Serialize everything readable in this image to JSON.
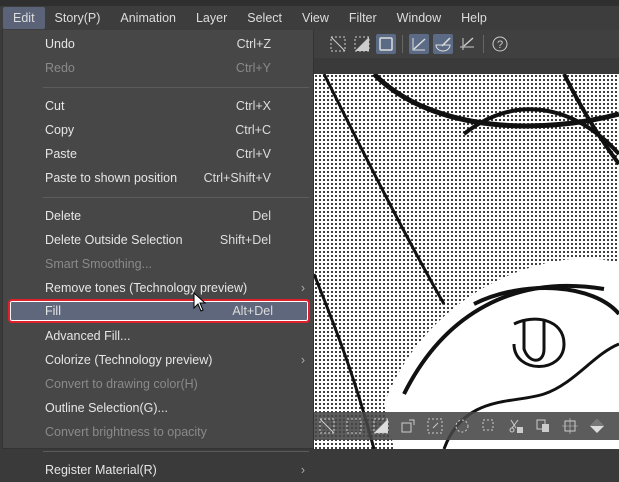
{
  "menubar": [
    "Edit",
    "Story(P)",
    "Animation",
    "Layer",
    "Select",
    "View",
    "Filter",
    "Window",
    "Help"
  ],
  "edit_menu": [
    {
      "label": "Undo",
      "shortcut": "Ctrl+Z",
      "disabled": false
    },
    {
      "label": "Redo",
      "shortcut": "Ctrl+Y",
      "disabled": true
    },
    {
      "label": "Cut",
      "shortcut": "Ctrl+X",
      "disabled": false
    },
    {
      "label": "Copy",
      "shortcut": "Ctrl+C",
      "disabled": false
    },
    {
      "label": "Paste",
      "shortcut": "Ctrl+V",
      "disabled": false
    },
    {
      "label": "Paste to shown position",
      "shortcut": "Ctrl+Shift+V",
      "disabled": false
    },
    {
      "label": "Delete",
      "shortcut": "Del",
      "disabled": false
    },
    {
      "label": "Delete Outside Selection",
      "shortcut": "Shift+Del",
      "disabled": false
    },
    {
      "label": "Smart Smoothing...",
      "shortcut": "",
      "disabled": true
    },
    {
      "label": "Remove tones (Technology preview)",
      "shortcut": "",
      "disabled": false,
      "submenu": true
    },
    {
      "label": "Fill",
      "shortcut": "Alt+Del",
      "disabled": false,
      "highlighted": true
    },
    {
      "label": "Advanced Fill...",
      "shortcut": "",
      "disabled": false
    },
    {
      "label": "Colorize (Technology preview)",
      "shortcut": "",
      "disabled": false,
      "submenu": true
    },
    {
      "label": "Convert to drawing color(H)",
      "shortcut": "",
      "disabled": true
    },
    {
      "label": "Outline Selection(G)...",
      "shortcut": "",
      "disabled": false
    },
    {
      "label": "Convert brightness to opacity",
      "shortcut": "",
      "disabled": true
    },
    {
      "label": "Register Material(R)",
      "shortcut": "",
      "disabled": false,
      "submenu": true
    }
  ],
  "colors": {
    "highlight": "#5f677c",
    "outline": "#e0202a",
    "menu_bg": "#474747"
  }
}
